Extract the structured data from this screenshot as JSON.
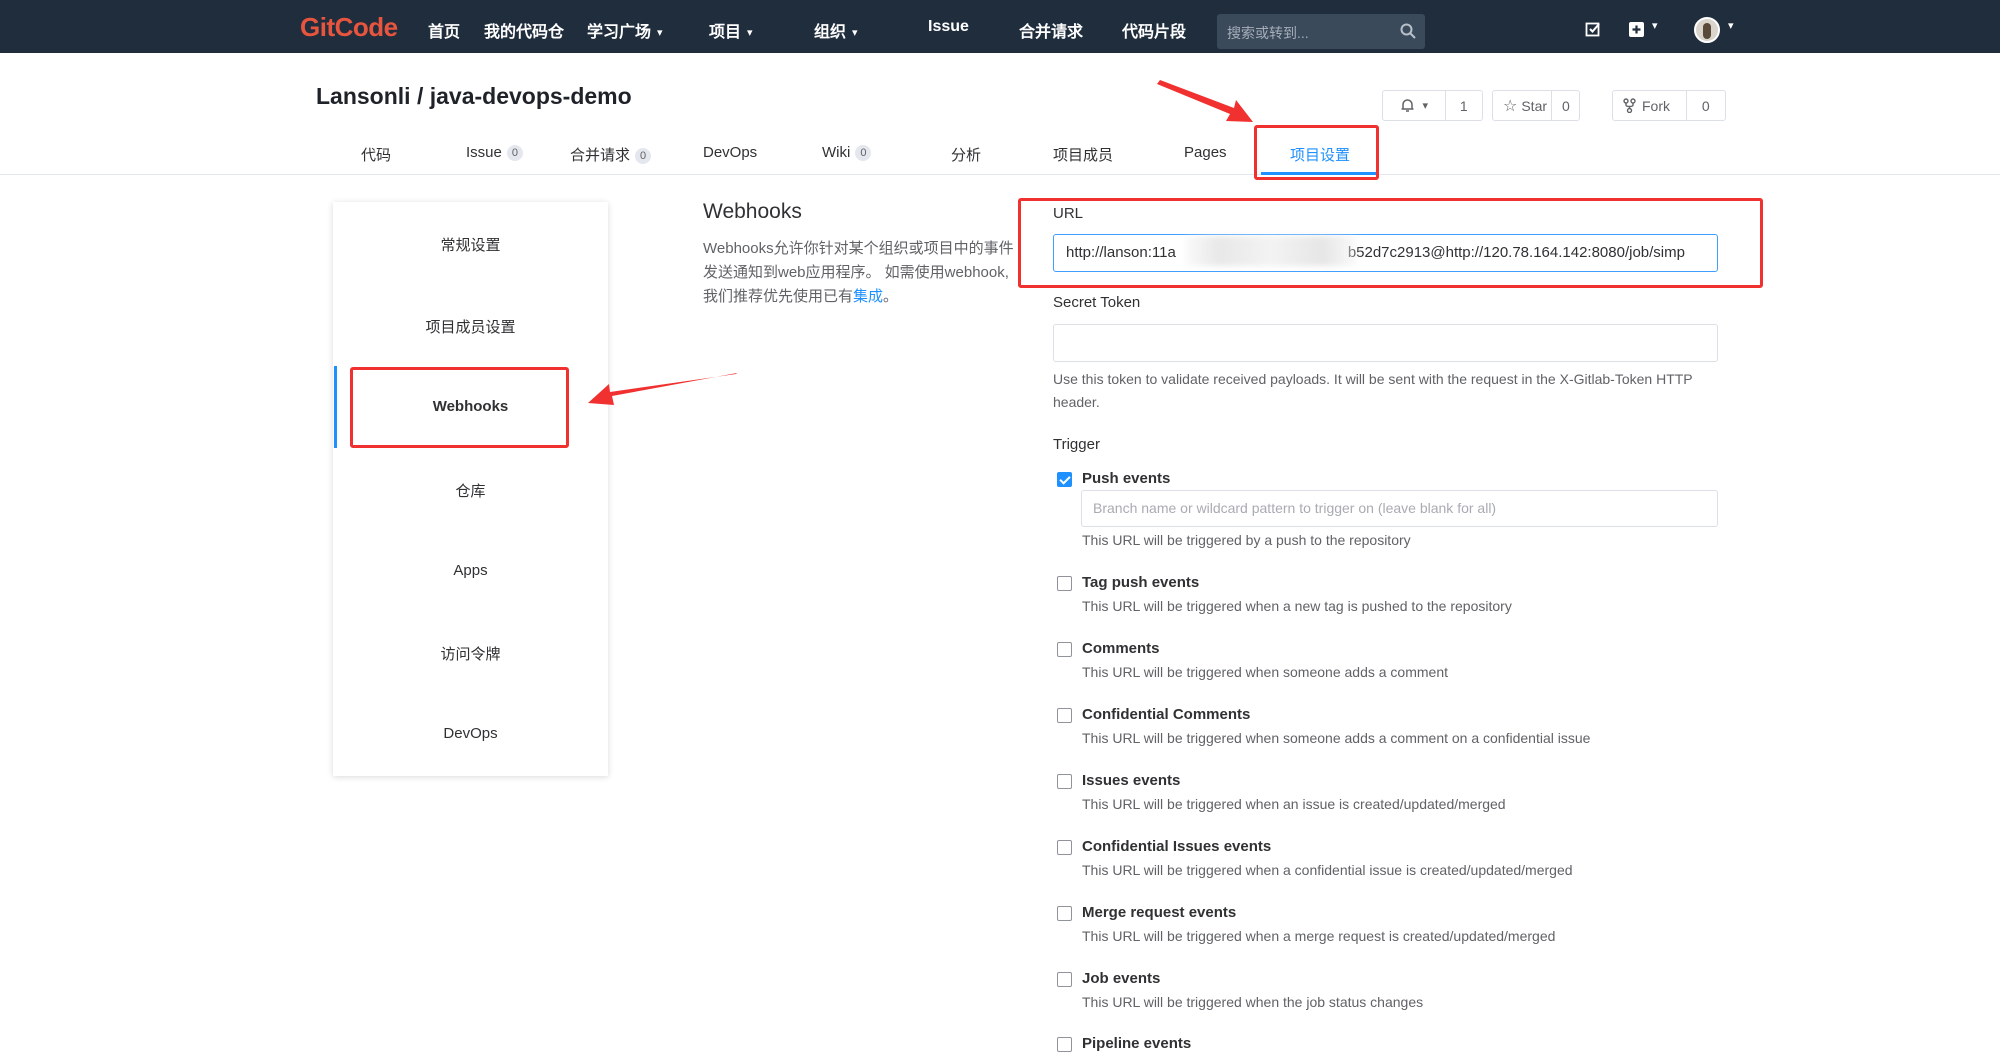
{
  "topnav": {
    "logo": "GitCode",
    "items": [
      "首页",
      "我的代码仓",
      "学习广场",
      "项目",
      "组织",
      "Issue",
      "合并请求",
      "代码片段"
    ],
    "search_placeholder": "搜索或转到..."
  },
  "project": {
    "title": "Lansonli / java-devops-demo",
    "watch_count": "1",
    "star_label": "Star",
    "star_count": "0",
    "fork_label": "Fork",
    "fork_count": "0"
  },
  "tabs": [
    {
      "label": "代码"
    },
    {
      "label": "Issue",
      "count": "0"
    },
    {
      "label": "合并请求",
      "count": "0"
    },
    {
      "label": "DevOps"
    },
    {
      "label": "Wiki",
      "count": "0"
    },
    {
      "label": "分析"
    },
    {
      "label": "项目成员"
    },
    {
      "label": "Pages"
    },
    {
      "label": "项目设置"
    }
  ],
  "sidebar": {
    "items": [
      "常规设置",
      "项目成员设置",
      "Webhooks",
      "仓库",
      "Apps",
      "访问令牌",
      "DevOps"
    ]
  },
  "intro": {
    "title": "Webhooks",
    "desc": "Webhooks允许你针对某个组织或项目中的事件发送通知到web应用程序。 如需使用webhook, 我们推荐优先使用已有",
    "link": "集成",
    "end": "。"
  },
  "form": {
    "url_label": "URL",
    "url_value_start": "http://lanson:11a",
    "url_value_end": "b52d7c2913@http://120.78.164.142:8080/job/simp",
    "secret_label": "Secret Token",
    "secret_help": "Use this token to validate received payloads. It will be sent with the request in the X-Gitlab-Token HTTP header.",
    "trigger_label": "Trigger",
    "branch_placeholder": "Branch name or wildcard pattern to trigger on (leave blank for all)"
  },
  "triggers": [
    {
      "title": "Push events",
      "desc": "This URL will be triggered by a push to the repository",
      "checked": true
    },
    {
      "title": "Tag push events",
      "desc": "This URL will be triggered when a new tag is pushed to the repository",
      "checked": false
    },
    {
      "title": "Comments",
      "desc": "This URL will be triggered when someone adds a comment",
      "checked": false
    },
    {
      "title": "Confidential Comments",
      "desc": "This URL will be triggered when someone adds a comment on a confidential issue",
      "checked": false
    },
    {
      "title": "Issues events",
      "desc": "This URL will be triggered when an issue is created/updated/merged",
      "checked": false
    },
    {
      "title": "Confidential Issues events",
      "desc": "This URL will be triggered when a confidential issue is created/updated/merged",
      "checked": false
    },
    {
      "title": "Merge request events",
      "desc": "This URL will be triggered when a merge request is created/updated/merged",
      "checked": false
    },
    {
      "title": "Job events",
      "desc": "This URL will be triggered when the job status changes",
      "checked": false
    },
    {
      "title": "Pipeline events",
      "desc": "",
      "checked": false
    }
  ],
  "colors": {
    "accent": "#1e90ff",
    "annotation": "#f0312f",
    "nav_bg": "#1f2d3d"
  }
}
